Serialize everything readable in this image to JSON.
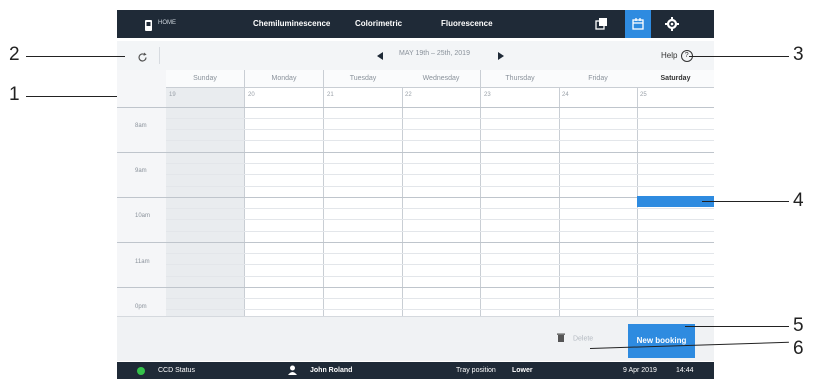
{
  "topbar": {
    "home": "HOME",
    "tabs": [
      "Chemiluminescence",
      "Colorimetric",
      "Fluorescence"
    ]
  },
  "subheader": {
    "week_range": "MAY 19th – 25th, 2019",
    "help": "Help"
  },
  "calendar": {
    "days": [
      "Sunday",
      "Monday",
      "Tuesday",
      "Wednesday",
      "Thursday",
      "Friday",
      "Saturday"
    ],
    "dates": [
      "19",
      "20",
      "21",
      "22",
      "23",
      "24",
      "25"
    ],
    "times": [
      "8am",
      "9am",
      "10am",
      "11am",
      "0pm"
    ],
    "selected_day": "Saturday",
    "booking": {
      "day": "Saturday",
      "time": "10am"
    }
  },
  "actions": {
    "delete": "Delete",
    "new_booking": "New booking"
  },
  "status": {
    "ccd": "CCD Status",
    "user": "John Roland",
    "tray_label": "Tray position",
    "tray_value": "Lower",
    "date": "9 Apr 2019",
    "time": "14:44"
  },
  "callouts": [
    "1",
    "2",
    "3",
    "4",
    "5",
    "6"
  ],
  "colors": {
    "topbar": "#1f2a37",
    "accent": "#2e8be0",
    "status_dot": "#34c24a"
  }
}
